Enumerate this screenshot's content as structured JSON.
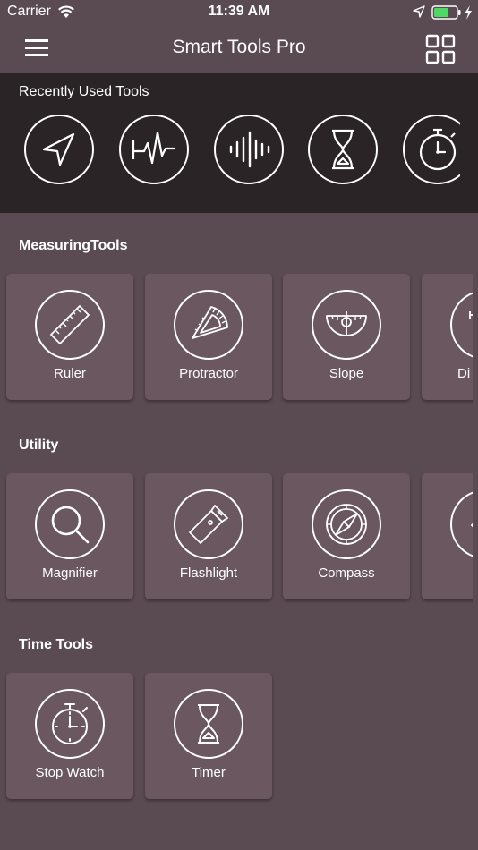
{
  "status_bar": {
    "carrier": "Carrier",
    "time": "11:39 AM",
    "battery_color": "#4cd964"
  },
  "nav": {
    "title": "Smart Tools Pro",
    "menu_icon": "hamburger-menu-icon",
    "grid_icon": "grid-view-icon"
  },
  "recent": {
    "heading": "Recently Used Tools",
    "items": [
      {
        "icon": "navigation-arrow-icon"
      },
      {
        "icon": "seismometer-wave-icon"
      },
      {
        "icon": "sound-wave-icon"
      },
      {
        "icon": "hourglass-icon"
      },
      {
        "icon": "stopwatch-icon"
      }
    ]
  },
  "sections": {
    "measuring": {
      "title": "MeasuringTools",
      "items": [
        {
          "label": "Ruler",
          "icon": "ruler-icon"
        },
        {
          "label": "Protractor",
          "icon": "protractor-icon"
        },
        {
          "label": "Slope",
          "icon": "slope-icon"
        },
        {
          "label": "Di",
          "icon": "distance-icon"
        }
      ]
    },
    "utility": {
      "title": "Utility",
      "items": [
        {
          "label": "Magnifier",
          "icon": "magnifier-icon"
        },
        {
          "label": "Flashlight",
          "icon": "flashlight-icon"
        },
        {
          "label": "Compass",
          "icon": "compass-icon"
        },
        {
          "label": "",
          "icon": "partial-tool-icon"
        }
      ]
    },
    "time": {
      "title": "Time Tools",
      "items": [
        {
          "label": "Stop Watch",
          "icon": "stopwatch-icon"
        },
        {
          "label": "Timer",
          "icon": "hourglass-icon"
        }
      ]
    }
  },
  "colors": {
    "background": "#5a4a52",
    "recent_bg": "#2b2427",
    "card_bg": "#6a5760",
    "foreground": "#ffffff"
  }
}
